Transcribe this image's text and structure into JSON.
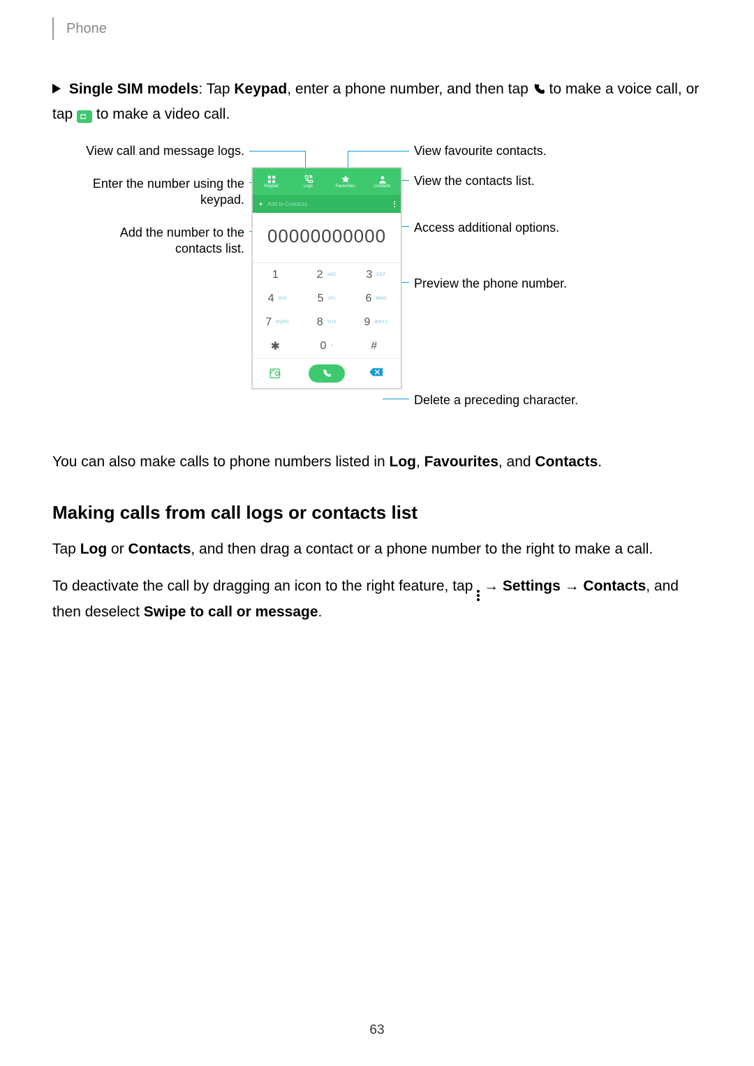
{
  "header": {
    "title": "Phone"
  },
  "intro": {
    "prefix_bold": "Single SIM models",
    "after_colon": ": Tap ",
    "keypad_bold": "Keypad",
    "mid1": ", enter a phone number, and then tap ",
    "mid2": " to make a voice call, or tap ",
    "mid3": " to make a video call."
  },
  "callouts": {
    "left1": "View call and message logs.",
    "left2": "Enter the number using the keypad.",
    "left3": "Add the number to the contacts list.",
    "right1": "View favourite contacts.",
    "right2": "View the contacts list.",
    "right3": "Access additional options.",
    "right4": "Preview the phone number.",
    "right5": "Delete a preceding character."
  },
  "phone_ui": {
    "tabs": [
      "Keypad",
      "Logs",
      "Favourites",
      "Contacts"
    ],
    "add_label": "Add to Contacts",
    "number": "00000000000",
    "keys": [
      {
        "d": "1",
        "s": ""
      },
      {
        "d": "2",
        "s": "ABC"
      },
      {
        "d": "3",
        "s": "DEF"
      },
      {
        "d": "4",
        "s": "GHI"
      },
      {
        "d": "5",
        "s": "JKL"
      },
      {
        "d": "6",
        "s": "MNO"
      },
      {
        "d": "7",
        "s": "PQRS"
      },
      {
        "d": "8",
        "s": "TUV"
      },
      {
        "d": "9",
        "s": "WXYZ"
      },
      {
        "d": "✱",
        "s": ""
      },
      {
        "d": "0",
        "s": "+"
      },
      {
        "d": "#",
        "s": ""
      }
    ]
  },
  "body2": {
    "pre": "You can also make calls to phone numbers listed in ",
    "b1": "Log",
    "c1": ", ",
    "b2": "Favourites",
    "c2": ", and ",
    "b3": "Contacts",
    "c3": "."
  },
  "section_title": "Making calls from call logs or contacts list",
  "body3": {
    "pre": "Tap ",
    "b1": "Log",
    "mid1": " or ",
    "b2": "Contacts",
    "mid2": ", and then drag a contact or a phone number to the right to make a call."
  },
  "body4": {
    "pre": "To deactivate the call by dragging an icon to the right feature, tap ",
    "arrow": " → ",
    "b1": "Settings",
    "b2": "Contacts",
    "mid": ", and then deselect ",
    "b3": "Swipe to call or message",
    "end": "."
  },
  "page_number": "63"
}
